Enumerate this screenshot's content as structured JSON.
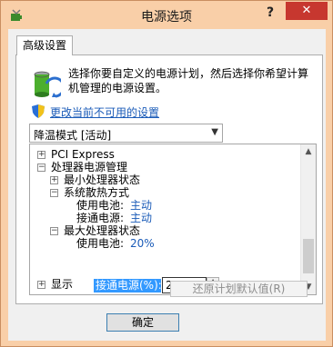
{
  "window": {
    "title": "电源选项",
    "help_label": "?",
    "close_label": "✕"
  },
  "tabs": [
    {
      "label": "高级设置"
    }
  ],
  "description": "选择你要自定义的电源计划，然后选择你希望计算机管理的电源设置。",
  "change_link": "更改当前不可用的设置",
  "plan_select": {
    "value": "降温模式 [活动]"
  },
  "tree": {
    "pci": {
      "label": "PCI Express",
      "expander": "+"
    },
    "processor": {
      "label": "处理器电源管理",
      "expander": "−"
    },
    "min_state": {
      "label": "最小处理器状态",
      "expander": "+"
    },
    "cooling": {
      "label": "系统散热方式",
      "expander": "−"
    },
    "cooling_battery": {
      "label": "使用电池:",
      "value": "主动"
    },
    "cooling_ac": {
      "label": "接通电源:",
      "value": "主动"
    },
    "max_state": {
      "label": "最大处理器状态",
      "expander": "−"
    },
    "max_battery": {
      "label": "使用电池:",
      "value": "20%"
    },
    "max_ac": {
      "label": "接通电源(%):",
      "value": "20"
    },
    "display": {
      "label": "显示",
      "expander": "+"
    }
  },
  "restore_button": "还原计划默认值(R)",
  "ok_button": "确定",
  "colors": {
    "frame": "#f9cfa8",
    "close_red": "#c7372f",
    "link_blue": "#1a5bb8",
    "selection_blue": "#3399ff"
  }
}
